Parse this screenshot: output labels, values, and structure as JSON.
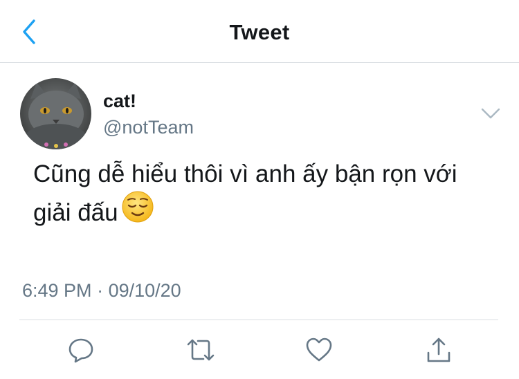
{
  "header": {
    "title": "Tweet",
    "back_icon": "chevron-left-icon"
  },
  "tweet": {
    "author_name": "cat!",
    "author_handle": "@notTeam",
    "text": "Cũng dễ hiểu thôi vì anh ấy bận rọn với giải đấu",
    "emoji": "relieved-face-emoji",
    "time": "6:49 PM",
    "separator": "·",
    "date": "09/10/20"
  },
  "actions": {
    "reply_icon": "reply-icon",
    "retweet_icon": "retweet-icon",
    "like_icon": "heart-icon",
    "share_icon": "share-icon"
  },
  "colors": {
    "accent": "#1da1f2",
    "secondary_text": "#657786",
    "icon_gray": "#657786",
    "divider": "#d8dde1"
  }
}
